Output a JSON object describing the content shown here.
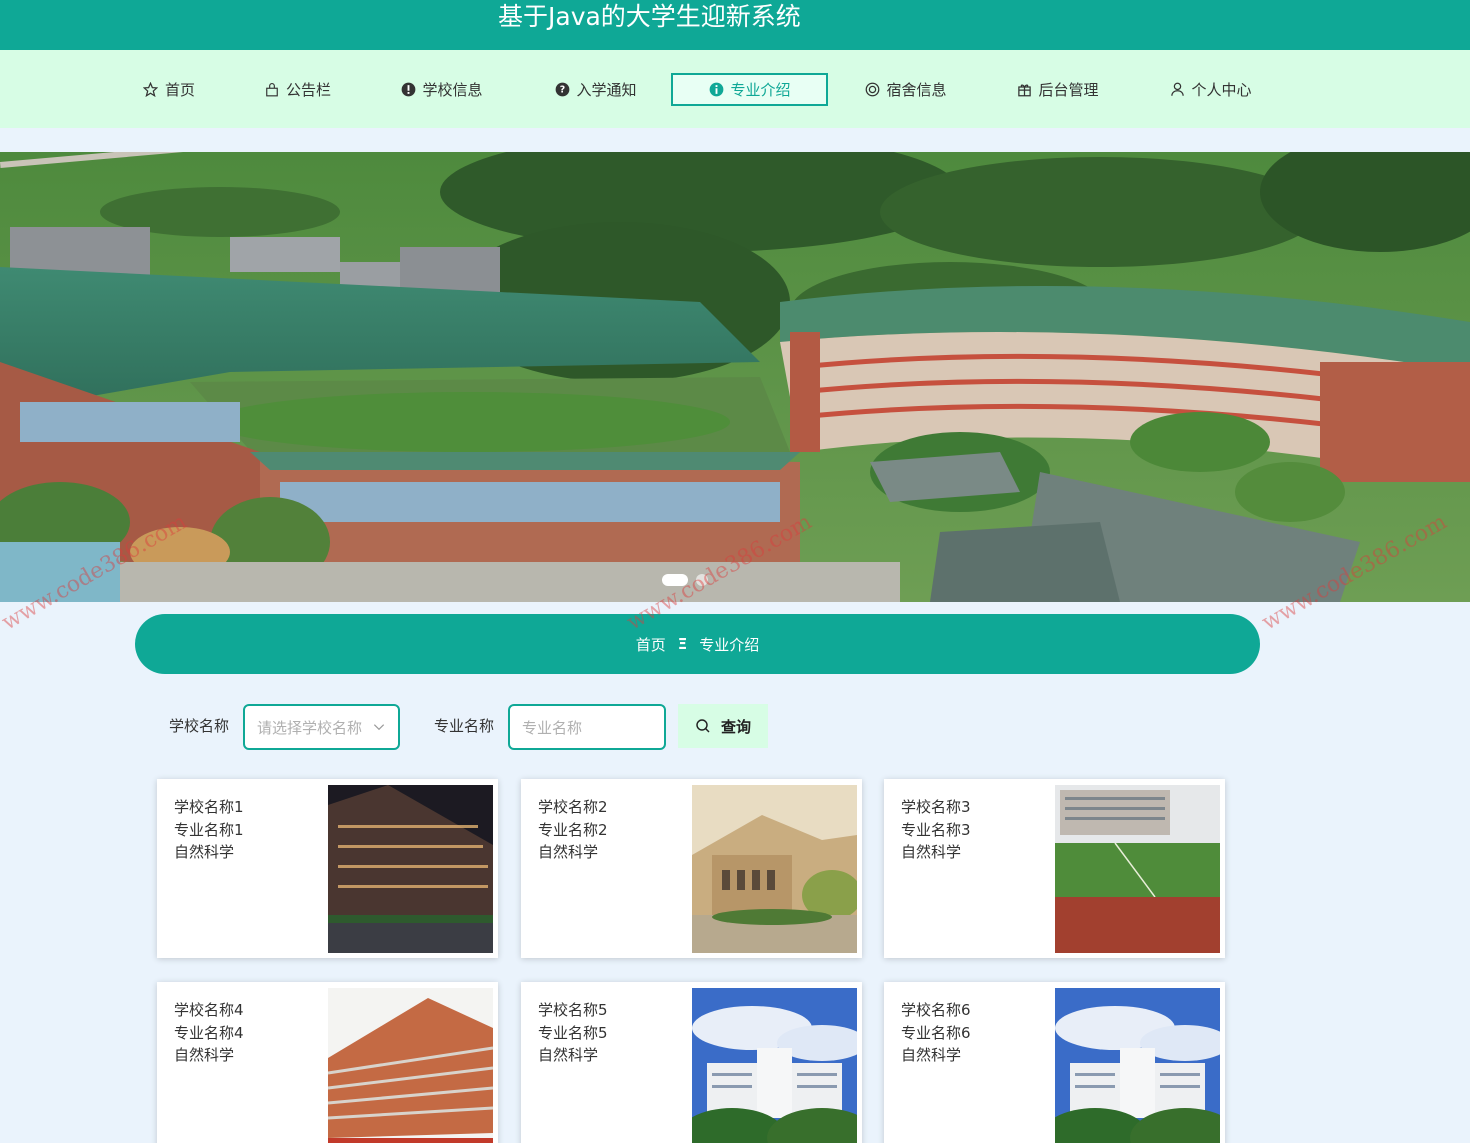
{
  "header": {
    "title": "基于Java的大学生迎新系统"
  },
  "nav": {
    "items": [
      {
        "label": "首页",
        "icon": "star-icon"
      },
      {
        "label": "公告栏",
        "icon": "bag-icon"
      },
      {
        "label": "学校信息",
        "icon": "alert-circle-icon"
      },
      {
        "label": "入学通知",
        "icon": "question-circle-icon"
      },
      {
        "label": "专业介绍",
        "icon": "info-circle-icon",
        "active": true
      },
      {
        "label": "宿舍信息",
        "icon": "target-icon"
      },
      {
        "label": "后台管理",
        "icon": "gift-icon"
      },
      {
        "label": "个人中心",
        "icon": "user-icon"
      }
    ]
  },
  "breadcrumb": {
    "home": "首页",
    "separator": "Ξ",
    "current": "专业介绍"
  },
  "filters": {
    "school_label": "学校名称",
    "school_placeholder": "请选择学校名称",
    "major_label": "专业名称",
    "major_placeholder": "专业名称",
    "query_label": "查询"
  },
  "cards": [
    {
      "school": "学校名称1",
      "major": "专业名称1",
      "category": "自然科学",
      "image": "night-campus-building"
    },
    {
      "school": "学校名称2",
      "major": "专业名称2",
      "category": "自然科学",
      "image": "classical-hall"
    },
    {
      "school": "学校名称3",
      "major": "专业名称3",
      "category": "自然科学",
      "image": "sports-field"
    },
    {
      "school": "学校名称4",
      "major": "专业名称4",
      "category": "自然科学",
      "image": "red-brick-building"
    },
    {
      "school": "学校名称5",
      "major": "专业名称5",
      "category": "自然科学",
      "image": "white-campus-blue-sky"
    },
    {
      "school": "学校名称6",
      "major": "专业名称6",
      "category": "自然科学",
      "image": "white-campus-blue-sky"
    }
  ],
  "watermark": "www.code386.com",
  "colors": {
    "primary": "#0fa896",
    "nav_bg": "#d7fde5",
    "page_bg": "#eaf3fc"
  }
}
